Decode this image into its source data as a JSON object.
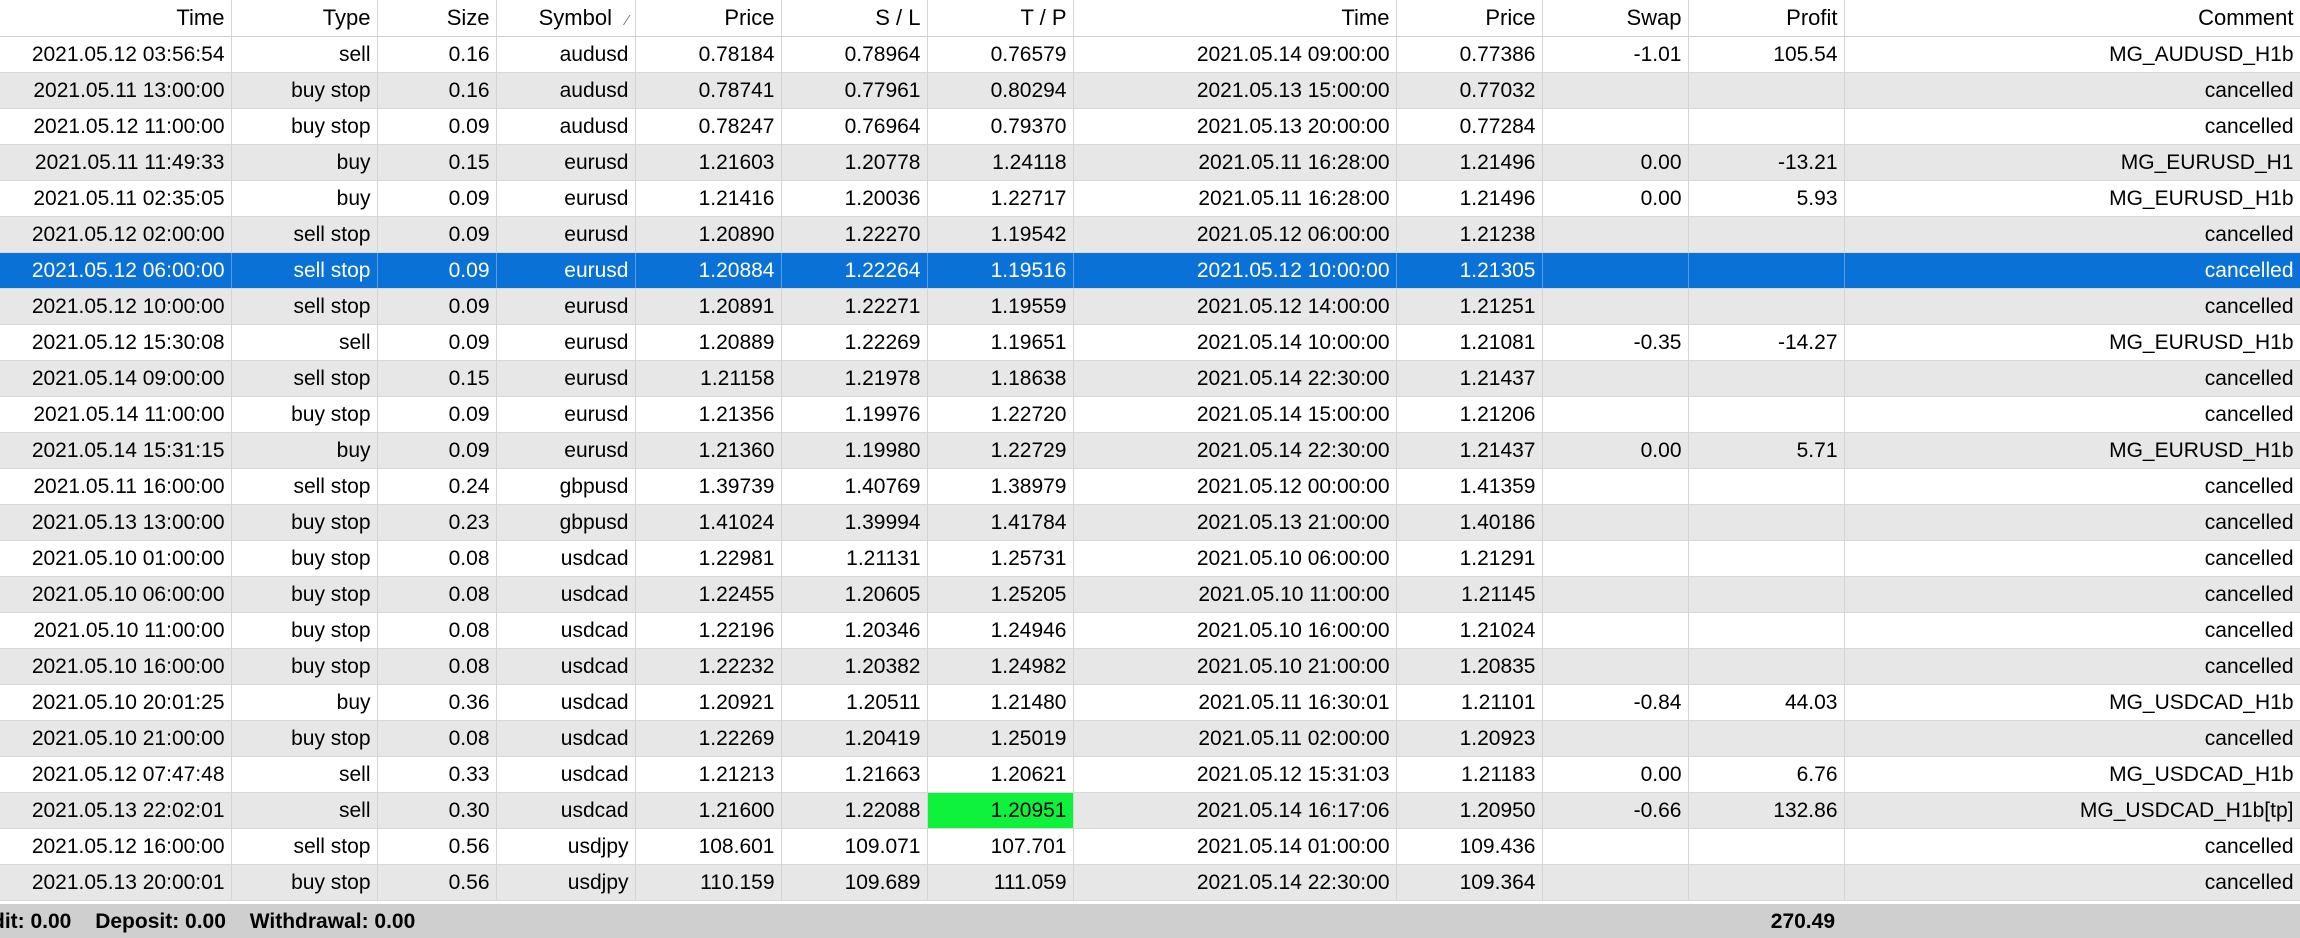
{
  "columns": [
    {
      "label": "Time"
    },
    {
      "label": "Type"
    },
    {
      "label": "Size"
    },
    {
      "label": "Symbol",
      "sort": "⁄"
    },
    {
      "label": "Price"
    },
    {
      "label": "S / L"
    },
    {
      "label": "T / P"
    },
    {
      "label": "Time"
    },
    {
      "label": "Price"
    },
    {
      "label": "Swap"
    },
    {
      "label": "Profit"
    },
    {
      "label": "Comment"
    }
  ],
  "rows": [
    [
      "2021.05.12 03:56:54",
      "sell",
      "0.16",
      "audusd",
      "0.78184",
      "0.78964",
      "0.76579",
      "2021.05.14 09:00:00",
      "0.77386",
      "-1.01",
      "105.54",
      "MG_AUDUSD_H1b"
    ],
    [
      "2021.05.11 13:00:00",
      "buy stop",
      "0.16",
      "audusd",
      "0.78741",
      "0.77961",
      "0.80294",
      "2021.05.13 15:00:00",
      "0.77032",
      "",
      "",
      "cancelled"
    ],
    [
      "2021.05.12 11:00:00",
      "buy stop",
      "0.09",
      "audusd",
      "0.78247",
      "0.76964",
      "0.79370",
      "2021.05.13 20:00:00",
      "0.77284",
      "",
      "",
      "cancelled"
    ],
    [
      "2021.05.11 11:49:33",
      "buy",
      "0.15",
      "eurusd",
      "1.21603",
      "1.20778",
      "1.24118",
      "2021.05.11 16:28:00",
      "1.21496",
      "0.00",
      "-13.21",
      "MG_EURUSD_H1"
    ],
    [
      "2021.05.11 02:35:05",
      "buy",
      "0.09",
      "eurusd",
      "1.21416",
      "1.20036",
      "1.22717",
      "2021.05.11 16:28:00",
      "1.21496",
      "0.00",
      "5.93",
      "MG_EURUSD_H1b"
    ],
    [
      "2021.05.12 02:00:00",
      "sell stop",
      "0.09",
      "eurusd",
      "1.20890",
      "1.22270",
      "1.19542",
      "2021.05.12 06:00:00",
      "1.21238",
      "",
      "",
      "cancelled"
    ],
    [
      "2021.05.12 06:00:00",
      "sell stop",
      "0.09",
      "eurusd",
      "1.20884",
      "1.22264",
      "1.19516",
      "2021.05.12 10:00:00",
      "1.21305",
      "",
      "",
      "cancelled"
    ],
    [
      "2021.05.12 10:00:00",
      "sell stop",
      "0.09",
      "eurusd",
      "1.20891",
      "1.22271",
      "1.19559",
      "2021.05.12 14:00:00",
      "1.21251",
      "",
      "",
      "cancelled"
    ],
    [
      "2021.05.12 15:30:08",
      "sell",
      "0.09",
      "eurusd",
      "1.20889",
      "1.22269",
      "1.19651",
      "2021.05.14 10:00:00",
      "1.21081",
      "-0.35",
      "-14.27",
      "MG_EURUSD_H1b"
    ],
    [
      "2021.05.14 09:00:00",
      "sell stop",
      "0.15",
      "eurusd",
      "1.21158",
      "1.21978",
      "1.18638",
      "2021.05.14 22:30:00",
      "1.21437",
      "",
      "",
      "cancelled"
    ],
    [
      "2021.05.14 11:00:00",
      "buy stop",
      "0.09",
      "eurusd",
      "1.21356",
      "1.19976",
      "1.22720",
      "2021.05.14 15:00:00",
      "1.21206",
      "",
      "",
      "cancelled"
    ],
    [
      "2021.05.14 15:31:15",
      "buy",
      "0.09",
      "eurusd",
      "1.21360",
      "1.19980",
      "1.22729",
      "2021.05.14 22:30:00",
      "1.21437",
      "0.00",
      "5.71",
      "MG_EURUSD_H1b"
    ],
    [
      "2021.05.11 16:00:00",
      "sell stop",
      "0.24",
      "gbpusd",
      "1.39739",
      "1.40769",
      "1.38979",
      "2021.05.12 00:00:00",
      "1.41359",
      "",
      "",
      "cancelled"
    ],
    [
      "2021.05.13 13:00:00",
      "buy stop",
      "0.23",
      "gbpusd",
      "1.41024",
      "1.39994",
      "1.41784",
      "2021.05.13 21:00:00",
      "1.40186",
      "",
      "",
      "cancelled"
    ],
    [
      "2021.05.10 01:00:00",
      "buy stop",
      "0.08",
      "usdcad",
      "1.22981",
      "1.21131",
      "1.25731",
      "2021.05.10 06:00:00",
      "1.21291",
      "",
      "",
      "cancelled"
    ],
    [
      "2021.05.10 06:00:00",
      "buy stop",
      "0.08",
      "usdcad",
      "1.22455",
      "1.20605",
      "1.25205",
      "2021.05.10 11:00:00",
      "1.21145",
      "",
      "",
      "cancelled"
    ],
    [
      "2021.05.10 11:00:00",
      "buy stop",
      "0.08",
      "usdcad",
      "1.22196",
      "1.20346",
      "1.24946",
      "2021.05.10 16:00:00",
      "1.21024",
      "",
      "",
      "cancelled"
    ],
    [
      "2021.05.10 16:00:00",
      "buy stop",
      "0.08",
      "usdcad",
      "1.22232",
      "1.20382",
      "1.24982",
      "2021.05.10 21:00:00",
      "1.20835",
      "",
      "",
      "cancelled"
    ],
    [
      "2021.05.10 20:01:25",
      "buy",
      "0.36",
      "usdcad",
      "1.20921",
      "1.20511",
      "1.21480",
      "2021.05.11 16:30:01",
      "1.21101",
      "-0.84",
      "44.03",
      "MG_USDCAD_H1b"
    ],
    [
      "2021.05.10 21:00:00",
      "buy stop",
      "0.08",
      "usdcad",
      "1.22269",
      "1.20419",
      "1.25019",
      "2021.05.11 02:00:00",
      "1.20923",
      "",
      "",
      "cancelled"
    ],
    [
      "2021.05.12 07:47:48",
      "sell",
      "0.33",
      "usdcad",
      "1.21213",
      "1.21663",
      "1.20621",
      "2021.05.12 15:31:03",
      "1.21183",
      "0.00",
      "6.76",
      "MG_USDCAD_H1b"
    ],
    [
      "2021.05.13 22:02:01",
      "sell",
      "0.30",
      "usdcad",
      "1.21600",
      "1.22088",
      "1.20951",
      "2021.05.14 16:17:06",
      "1.20950",
      "-0.66",
      "132.86",
      "MG_USDCAD_H1b[tp]"
    ],
    [
      "2021.05.12 16:00:00",
      "sell stop",
      "0.56",
      "usdjpy",
      "108.601",
      "109.071",
      "107.701",
      "2021.05.14 01:00:00",
      "109.436",
      "",
      "",
      "cancelled"
    ],
    [
      "2021.05.13 20:00:01",
      "buy stop",
      "0.56",
      "usdjpy",
      "110.159",
      "109.689",
      "111.059",
      "2021.05.14 22:30:00",
      "109.364",
      "",
      "",
      "cancelled"
    ]
  ],
  "selected_row": 6,
  "tp_hit_row": 21,
  "summary": {
    "credit": "dit: 0.00",
    "deposit": "Deposit: 0.00",
    "withdrawal": "Withdrawal: 0.00",
    "total_profit": "270.49"
  },
  "colors": {
    "selection": "#0a72d7",
    "tp_highlight": "#0ef23b",
    "alt_row": "#e7e7e7",
    "summary_bar": "#cfcfcf"
  }
}
